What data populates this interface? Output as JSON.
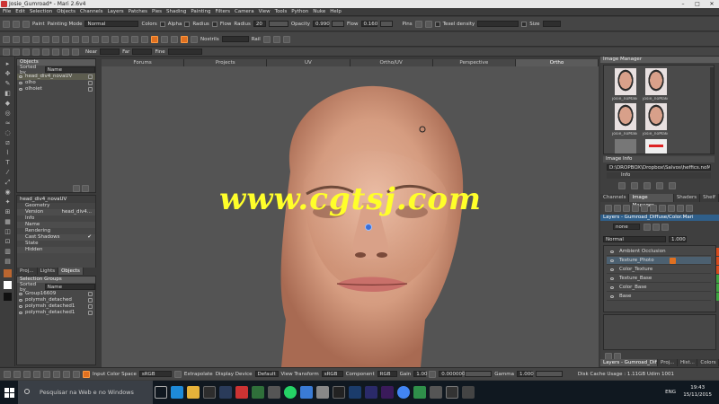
{
  "window": {
    "title": "Josie_Gumroad* - Mari 2.6v4",
    "controls": [
      "–",
      "□",
      "✕"
    ]
  },
  "menu": [
    "File",
    "Edit",
    "Selection",
    "Objects",
    "Channels",
    "Layers",
    "Patches",
    "Pies",
    "Shading",
    "Painting",
    "Filters",
    "Camera",
    "View",
    "Tools",
    "Python",
    "Nuke",
    "Help"
  ],
  "toolbar1": {
    "paint_label": "Paint",
    "mode_label": "Painting Mode",
    "mode_value": "Normal",
    "colors_label": "Colors",
    "alpha_label": "Alpha",
    "radius_label": "Radius",
    "flow_label": "Flow",
    "radius2_label": "Radius",
    "radius_value": "20",
    "opacity_label": "Opacity",
    "opacity_value": "0.990",
    "flow2_label": "Flow",
    "flow_value": "0.160",
    "pins_label": "Pins",
    "texel_label": "Texel density",
    "size_label": "Size"
  },
  "toolbar2": {
    "field1": "Nostrils",
    "field2": "Rail"
  },
  "toolbar3": {
    "label1": "Near",
    "label2": "Far",
    "label3": "Fine"
  },
  "objects_panel": {
    "header": "Objects",
    "sorted_by_label": "Sorted by",
    "sorted_by_value": "Name",
    "items": [
      "head_div4_novaUV",
      "olho",
      "olhoiet"
    ]
  },
  "properties_panel": {
    "object_name": "head_div4_novaUV",
    "rows": [
      {
        "label": "Geometry",
        "value": ""
      },
      {
        "label": "Version",
        "value": "head_div4..."
      },
      {
        "label": "Info",
        "value": ""
      },
      {
        "label": "Name",
        "value": ""
      },
      {
        "label": "Rendering",
        "value": ""
      },
      {
        "label": "Cast Shadows",
        "value": "✔"
      },
      {
        "label": "State",
        "value": ""
      },
      {
        "label": "Hidden",
        "value": ""
      }
    ],
    "tabs": [
      "Proj...",
      "Lights",
      "Objects",
      "Pat..."
    ]
  },
  "selection_groups": {
    "header": "Selection Groups",
    "sorted_by_label": "Sorted by",
    "sorted_by_value": "Name",
    "items": [
      "Group16609",
      "polymsh_detached",
      "polymsh_detached1",
      "polymsh_detached1"
    ]
  },
  "viewport": {
    "tabs": [
      "Forums",
      "Projects",
      "UV",
      "Ortho/UV",
      "Perspective",
      "Ortho"
    ],
    "active_tab": 5,
    "watermark": "www.cgtsj.com"
  },
  "image_manager": {
    "header": "Image Manager",
    "thumbs": [
      "josie_noMakeup...",
      "josie_noMakeup...",
      "josie_noMakeup...",
      "josie_noMakeup..."
    ],
    "info_header": "Image Info",
    "path": "D:\\DROPBOX\\Dropbox\\Salvos\\heffics.noMakeup...",
    "info_label": "Info",
    "tabs": [
      "Channels",
      "Image Manager",
      "Shaders",
      "Shelf"
    ]
  },
  "layers_panel": {
    "header": "Layers - Gumroad_Diffuse/Color.Mari",
    "name_field": "none",
    "blend_label": "Normal",
    "opacity_value": "1.000",
    "layers": [
      {
        "name": "Ambient Occlusion",
        "color": "#d84a1c"
      },
      {
        "name": "Texture_Photo",
        "color": "#d84a1c"
      },
      {
        "name": "Color_Texture",
        "color": "#d84a1c"
      },
      {
        "name": "Texture_Base",
        "color": "#3ea340"
      },
      {
        "name": "Color_Base",
        "color": "#3ea340"
      },
      {
        "name": "Base",
        "color": "#3ea340"
      }
    ],
    "selected_layer": 1,
    "tabs": [
      "Layers - Gumroad_Diffu...",
      "Proj...",
      "Hist...",
      "Colors"
    ]
  },
  "bottom_bar": {
    "input_label": "Input Color Space",
    "input_value": "sRGB",
    "extrapolate_label": "Extrapolate",
    "display_label": "Display Device",
    "display_value": "Default",
    "view_label": "View Transform",
    "view_value": "sRGB",
    "component_label": "Component",
    "component_value": "RGB",
    "gain_label": "Gain",
    "gain_value": "1.00",
    "gamma_label": "Gamma",
    "gamma_value": "1.000",
    "fstop_value": "0.000000",
    "disk_cache": "Disk Cache Usage : 1.11GB Udim 1001"
  },
  "taskbar": {
    "search_placeholder": "Pesquisar na Web e no Windows",
    "lang": "ENG",
    "time": "19:43",
    "date": "15/11/2015"
  }
}
